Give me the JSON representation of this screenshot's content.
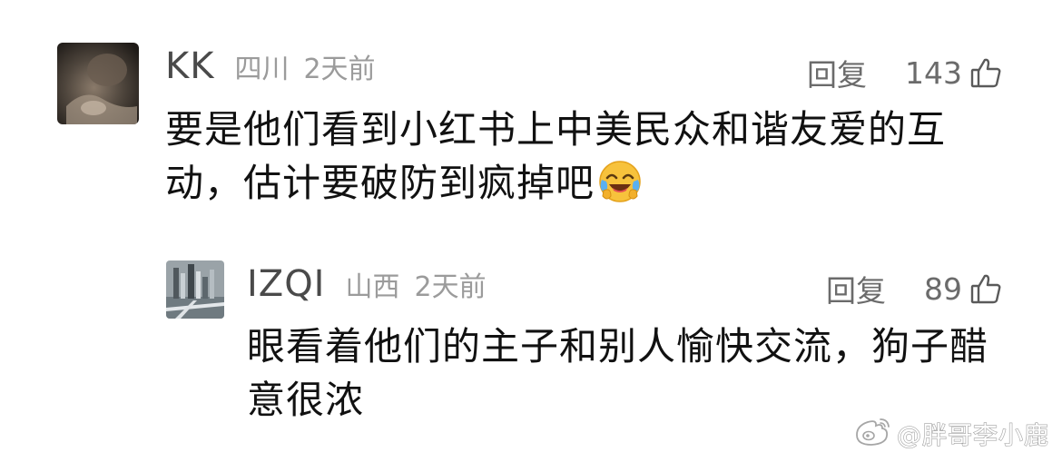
{
  "comments": [
    {
      "username": "KK",
      "location": "四川",
      "time": "2天前",
      "reply_label": "回复",
      "likes": "143",
      "content": "要是他们看到小红书上中美民众和谐友爱的互动，估计要破防到疯掉吧",
      "emoji": "crying-laughing-emoji"
    },
    {
      "username": "IZQI",
      "location": "山西",
      "time": "2天前",
      "reply_label": "回复",
      "likes": "89",
      "content": "眼看着他们的主子和别人愉快交流，狗子醋意很浓"
    }
  ],
  "watermark": {
    "text": "@胖哥李小鹿",
    "icon": "weibo-icon"
  },
  "colors": {
    "username": "#4a4a4a",
    "meta": "#9b9b9b",
    "action": "#6b6b6b",
    "content": "#111111",
    "background": "#ffffff"
  }
}
